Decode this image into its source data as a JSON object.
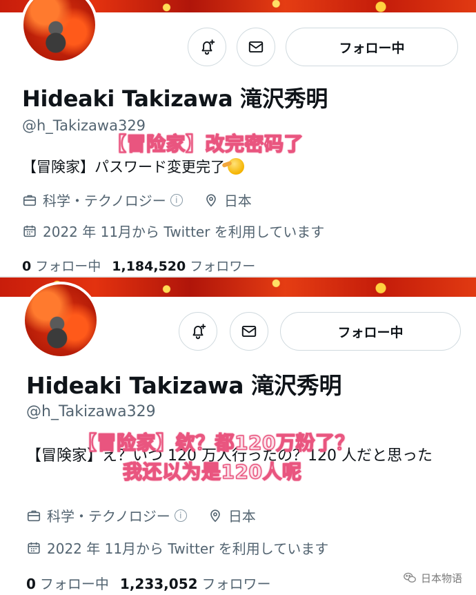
{
  "profiles": [
    {
      "name": "Hideaki Takizawa 滝沢秀明",
      "handle": "@h_Takizawa329",
      "follow_label": "フォロー中",
      "bio": "【冒険家】パスワード変更完了",
      "overlay_lines": [
        "【冒险家】改完密码了"
      ],
      "category": "科学・テクノロジー",
      "location": "日本",
      "joined": "2022 年 11月から Twitter を利用しています",
      "following_count": "0",
      "following_label": "フォロー中",
      "followers_count": "1,184,520",
      "followers_label": "フォロワー"
    },
    {
      "name": "Hideaki Takizawa 滝沢秀明",
      "handle": "@h_Takizawa329",
      "follow_label": "フォロー中",
      "bio": "【冒険家】え？いつ 120 万人行ったの？120 人だと思った",
      "overlay_lines": [
        "【冒险家】欸？都120万粉了？",
        "我还以为是120人呢"
      ],
      "category": "科学・テクノロジー",
      "location": "日本",
      "joined": "2022 年 11月から Twitter を利用しています",
      "following_count": "0",
      "following_label": "フォロー中",
      "followers_count": "1,233,052",
      "followers_label": "フォロワー"
    }
  ],
  "watermark": "日本物语",
  "icons": {
    "notify": "bell-plus-icon",
    "message": "envelope-icon",
    "category": "briefcase-icon",
    "info": "info-icon",
    "location": "location-pin-icon",
    "calendar": "calendar-icon",
    "wechat": "wechat-icon"
  },
  "colors": {
    "overlay_stroke": "#e9557f",
    "banner": "#d42a0c",
    "muted_text": "#536471"
  }
}
